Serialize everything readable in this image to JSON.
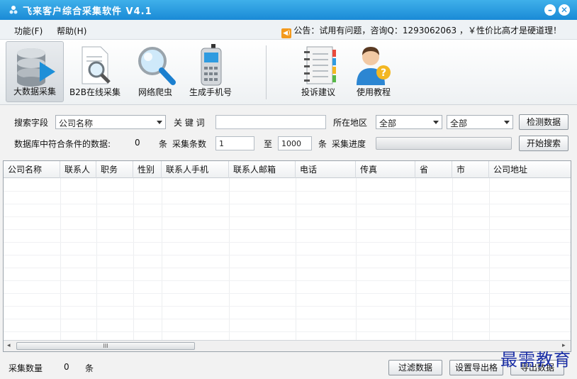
{
  "window": {
    "title": "飞来客户综合采集软件   V4.1",
    "minimize_glyph": "–",
    "close_glyph": "✕"
  },
  "menu": {
    "items": [
      "功能(F)",
      "帮助(H)"
    ]
  },
  "notice": {
    "text": "公告：试用有问题，咨询Q：1293062063 ，￥性价比高才是硬道理！"
  },
  "toolbar": {
    "tools": [
      {
        "label": "大数据采集",
        "icon": "database-icon"
      },
      {
        "label": "B2B在线采集",
        "icon": "document-search-icon"
      },
      {
        "label": "网络爬虫",
        "icon": "magnifier-icon"
      },
      {
        "label": "生成手机号",
        "icon": "phone-icon"
      },
      {
        "label": "投诉建议",
        "icon": "notebook-icon"
      },
      {
        "label": "使用教程",
        "icon": "help-user-icon"
      }
    ]
  },
  "search": {
    "field_label": "搜索字段",
    "field_value": "公司名称",
    "keyword_label": "关 键 词",
    "keyword_value": "",
    "region_label": "所在地区",
    "region1": "全部",
    "region2": "全部",
    "detect_button": "检测数据",
    "db_count_label": "数据库中符合条件的数据:",
    "db_count": "0",
    "unit1": "条",
    "collect_count_label": "采集条数",
    "from_value": "1",
    "to_label": "至",
    "to_value": "1000",
    "unit2": "条",
    "progress_label": "采集进度",
    "progress": 0,
    "start_button": "开始搜索"
  },
  "table": {
    "columns": [
      "公司名称",
      "联系人",
      "职务",
      "性别",
      "联系人手机",
      "联系人邮箱",
      "电话",
      "传真",
      "省",
      "市",
      "公司地址"
    ],
    "rows": []
  },
  "scrollbar": {
    "thumb_glyph": "III",
    "left_arrow": "◂",
    "right_arrow": "▸"
  },
  "status": {
    "count_label": "采集数量",
    "count": "0",
    "unit": "条",
    "filter_button": "过滤数据",
    "export_settings_button": "设置导出格",
    "export_button": "导出数据"
  },
  "watermark": {
    "text": "最需教育"
  }
}
